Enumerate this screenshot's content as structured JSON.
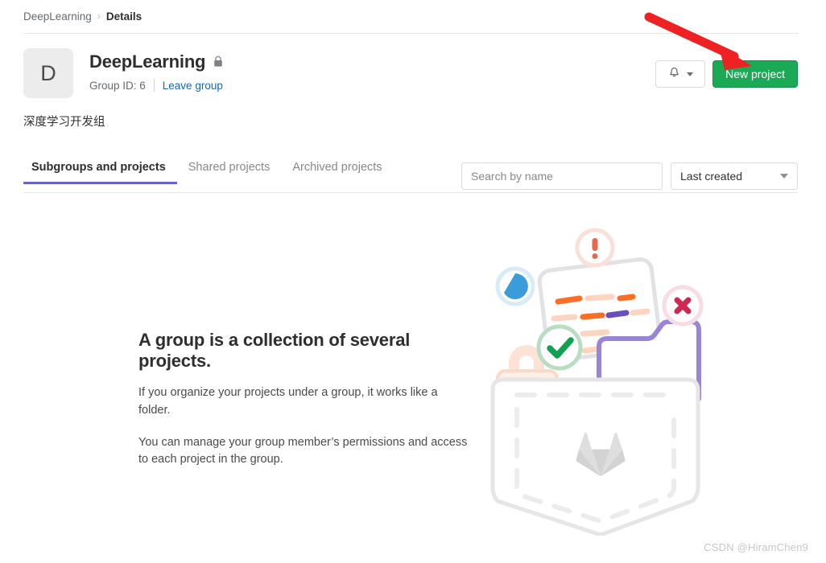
{
  "breadcrumb": {
    "group": "DeepLearning",
    "separator": "›",
    "current": "Details"
  },
  "group_header": {
    "avatar_letter": "D",
    "title": "DeepLearning",
    "visibility_icon": "lock-icon",
    "group_id_label": "Group ID: 6",
    "leave_link": "Leave group",
    "description": "深度学习开发组"
  },
  "header_actions": {
    "notification_icon": "bell-icon",
    "notification_chevron_icon": "chevron-down-icon",
    "new_project_label": "New project",
    "new_project_color": "#1aaa55"
  },
  "tabs": [
    {
      "label": "Subgroups and projects",
      "active": true
    },
    {
      "label": "Shared projects",
      "active": false
    },
    {
      "label": "Archived projects",
      "active": false
    }
  ],
  "tab_active_color": "#6666c4",
  "filters": {
    "search_placeholder": "Search by name",
    "search_value": "",
    "sort_value": "Last created",
    "sort_chevron_icon": "chevron-down-icon"
  },
  "empty_state": {
    "title": "A group is a collection of several projects.",
    "paragraph_1": "If you organize your projects under a group, it works like a folder.",
    "paragraph_2": "You can manage your group member’s permissions and access to each project in the group.",
    "illustration_name": "group-empty-pocket-illustration",
    "illustration_elements": [
      "exclamation-badge-icon",
      "pie-clock-icon",
      "close-x-badge-icon",
      "check-badge-icon",
      "lock-illustration-icon",
      "document-card",
      "purple-folder",
      "pocket-outline",
      "gitlab-tanuki-logo"
    ]
  },
  "annotation": {
    "arrow_color": "#ee2222",
    "arrow_points_to": "new-project-button"
  },
  "watermark": "CSDN @HiramChen9"
}
